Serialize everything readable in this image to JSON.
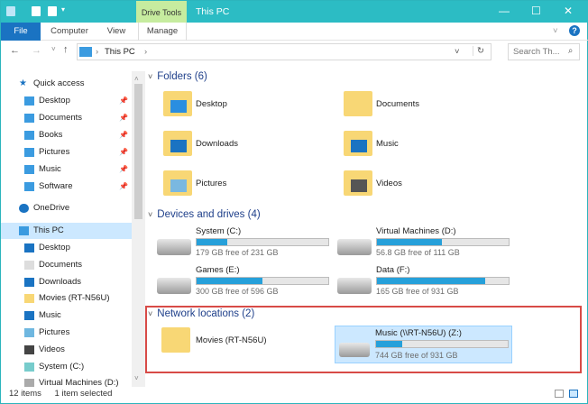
{
  "window": {
    "title": "This PC",
    "context_tab": "Drive Tools",
    "accent": "#2cbcc4",
    "minimize": "—",
    "maximize": "☐",
    "close": "✕"
  },
  "ribbon": {
    "tabs": [
      "File",
      "Computer",
      "View",
      "Manage"
    ],
    "help": "?",
    "expand": "˅"
  },
  "address": {
    "path": "This PC",
    "search_placeholder": "Search Th...",
    "back": "←",
    "forward": "→",
    "up": "↑",
    "recent": "˅",
    "refresh": "↻",
    "dropdown": "˅"
  },
  "sidebar": {
    "quick_access": "Quick access",
    "quick_items": [
      {
        "label": "Desktop",
        "pinned": true
      },
      {
        "label": "Documents",
        "pinned": true
      },
      {
        "label": "Books",
        "pinned": true
      },
      {
        "label": "Pictures",
        "pinned": true
      },
      {
        "label": "Music",
        "pinned": true
      },
      {
        "label": "Software",
        "pinned": true
      }
    ],
    "onedrive": "OneDrive",
    "this_pc": "This PC",
    "pc_items": [
      "Desktop",
      "Documents",
      "Downloads",
      "Movies (RT-N56U)",
      "Music",
      "Pictures",
      "Videos",
      "System (C:)",
      "Virtual Machines (D:)"
    ]
  },
  "folders": {
    "header": "Folders (6)",
    "items": [
      "Desktop",
      "Documents",
      "Downloads",
      "Music",
      "Pictures",
      "Videos"
    ]
  },
  "devices": {
    "header": "Devices and drives (4)",
    "items": [
      {
        "name": "System (C:)",
        "free": "179 GB free of 231 GB",
        "used_fraction": 0.23
      },
      {
        "name": "Virtual Machines (D:)",
        "free": "56.8 GB free of 111 GB",
        "used_fraction": 0.49
      },
      {
        "name": "Games (E:)",
        "free": "300 GB free of 596 GB",
        "used_fraction": 0.5
      },
      {
        "name": "Data (F:)",
        "free": "165 GB free of 931 GB",
        "used_fraction": 0.82
      }
    ]
  },
  "network": {
    "header": "Network locations (2)",
    "movies": "Movies (RT-N56U)",
    "music": {
      "name": "Music (\\\\RT-N56U) (Z:)",
      "free": "744 GB free of 931 GB",
      "used_fraction": 0.2
    }
  },
  "status": {
    "count": "12 items",
    "selected": "1 item selected"
  }
}
